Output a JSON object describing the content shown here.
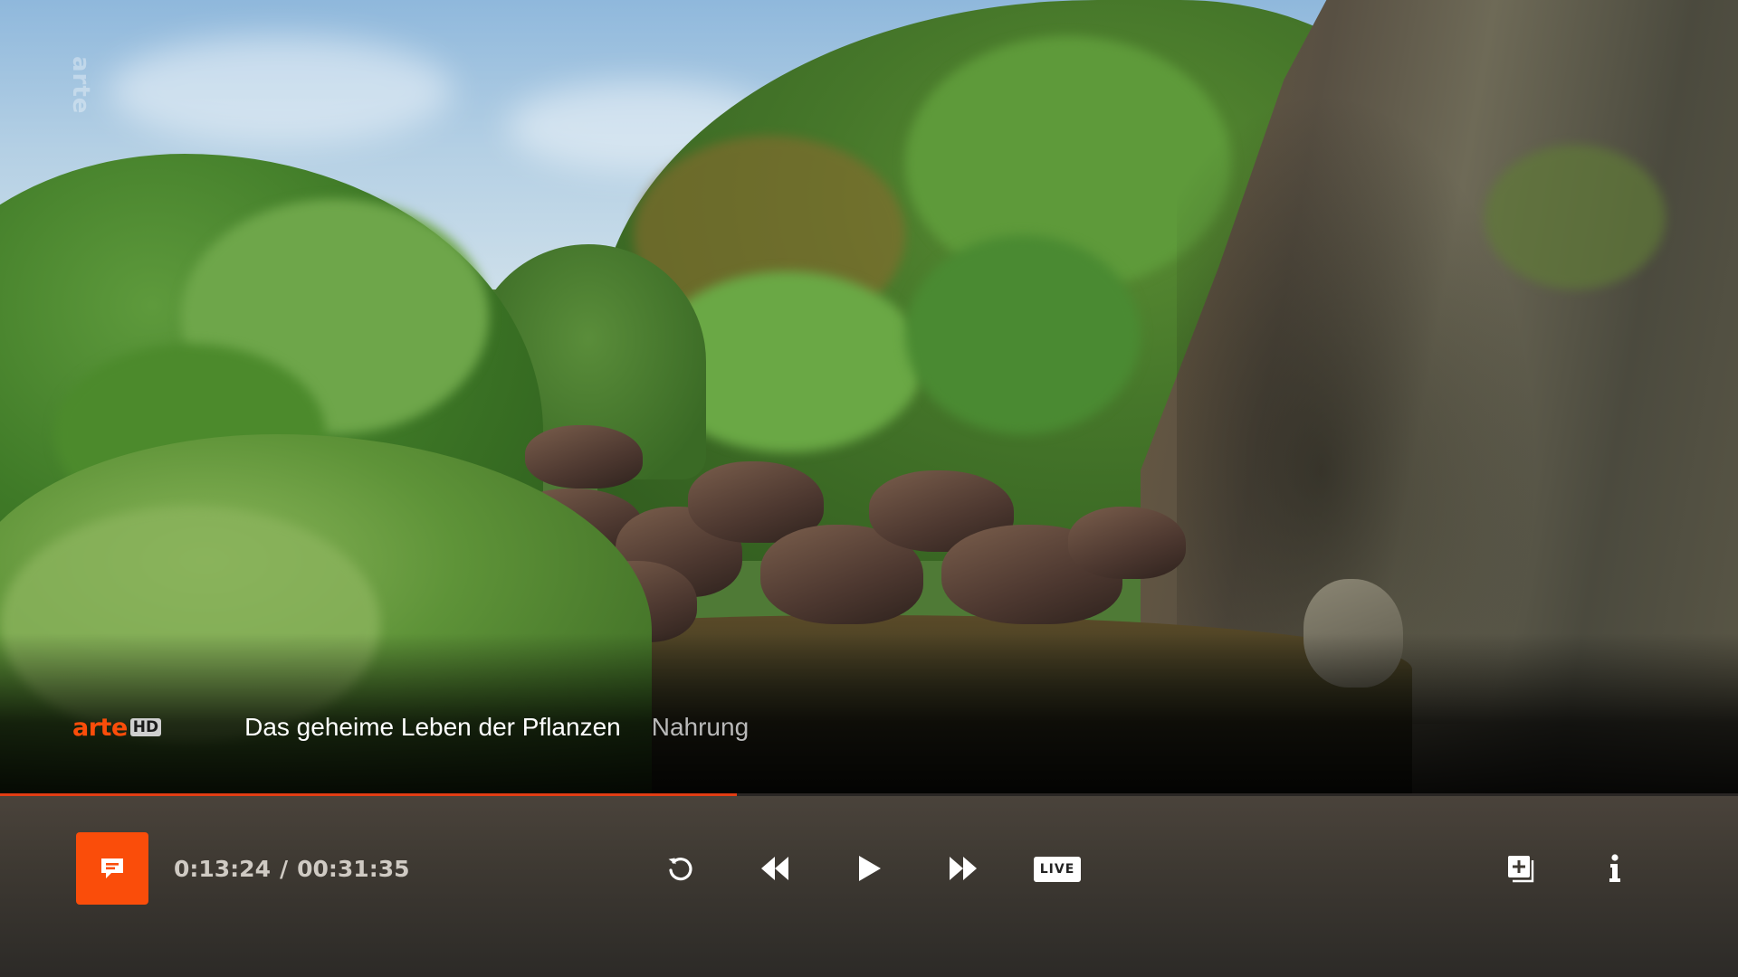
{
  "video": {
    "watermark": "arte"
  },
  "info": {
    "channel_name": "arte",
    "channel_badge": "HD",
    "program_title": "Das geheime Leben der Pflanzen",
    "episode_title": "Nahrung"
  },
  "playback": {
    "current_time": "0:13:24",
    "separator": "/",
    "total_time": "00:31:35",
    "progress_fraction": 0.424
  },
  "controls": {
    "subtitle_icon": "subtitles-icon",
    "restart_icon": "restart-icon",
    "rewind_icon": "rewind-icon",
    "play_icon": "play-icon",
    "fast_forward_icon": "fast-forward-icon",
    "live_label": "LIVE",
    "add_icon": "add-to-list-icon",
    "info_icon": "info-icon"
  },
  "colors": {
    "accent": "#fa4d0a",
    "progress": "#e23d14",
    "time_text": "#cfcac3",
    "episode_text": "#b9b9b9"
  }
}
